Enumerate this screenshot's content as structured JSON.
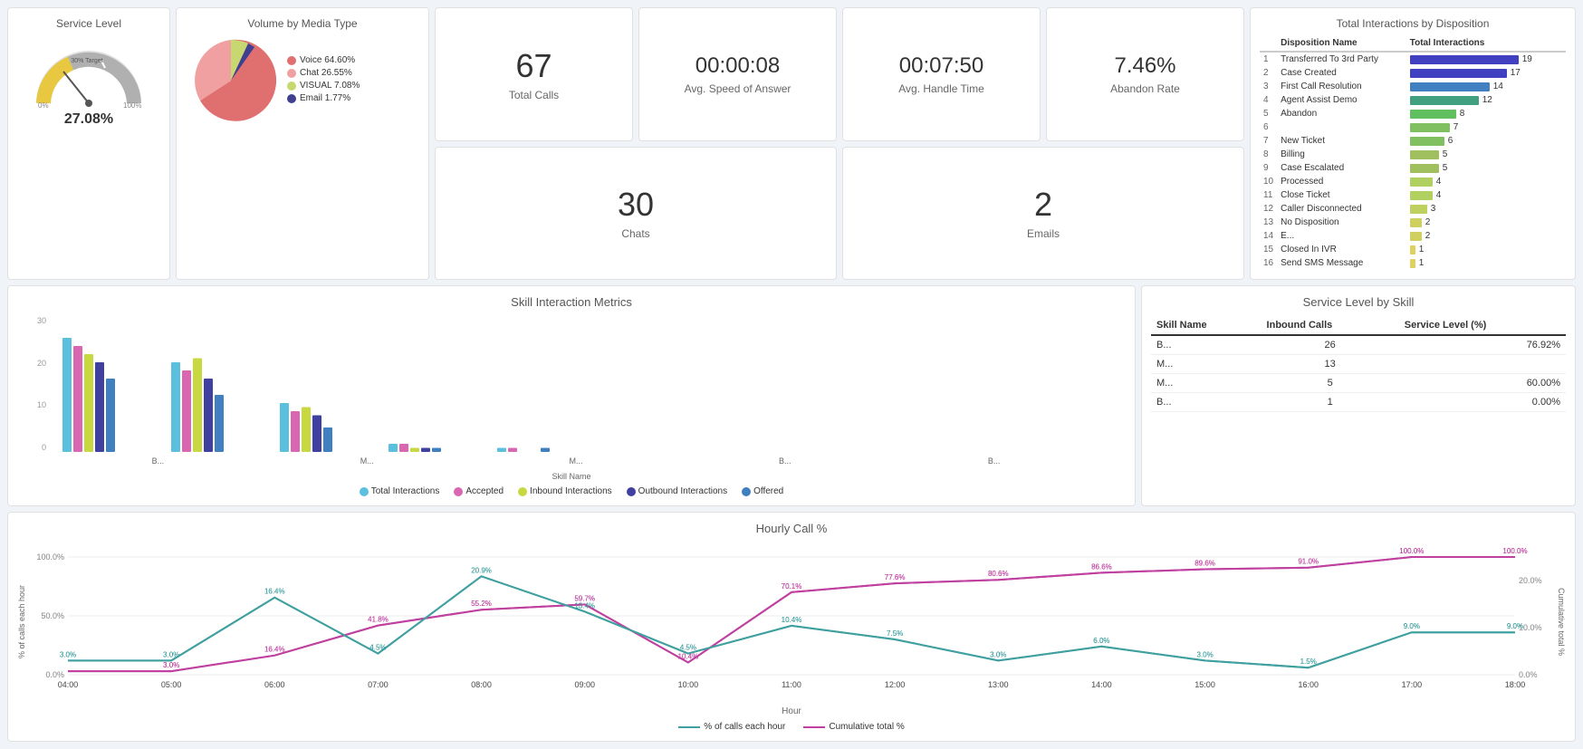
{
  "servicelevel": {
    "title": "Service Level",
    "value": "27.08%",
    "target": "30% Target",
    "gauge_pct": 27.08
  },
  "volume": {
    "title": "Volume by Media Type",
    "segments": [
      {
        "label": "Voice 64.60%",
        "pct": 64.6,
        "color": "#e07070"
      },
      {
        "label": "Chat 26.55%",
        "pct": 26.55,
        "color": "#f0a0a0"
      },
      {
        "label": "VISUAL 7.08%",
        "pct": 7.08,
        "color": "#c8d870"
      },
      {
        "label": "Email 1.77%",
        "pct": 1.77,
        "color": "#4040a0"
      }
    ]
  },
  "stats": {
    "total_calls": {
      "value": "67",
      "label": "Total Calls"
    },
    "avg_speed": {
      "value": "00:00:08",
      "label": "Avg. Speed of Answer"
    },
    "avg_handle": {
      "value": "00:07:50",
      "label": "Avg. Handle Time"
    },
    "abandon": {
      "value": "7.46%",
      "label": "Abandon Rate"
    },
    "chats": {
      "value": "30",
      "label": "Chats"
    },
    "emails": {
      "value": "2",
      "label": "Emails"
    }
  },
  "skill_metrics": {
    "title": "Skill Interaction Metrics",
    "x_label": "Skill Name",
    "y_max": 30,
    "groups": [
      {
        "name": "B...",
        "bars": [
          28,
          26,
          24,
          22,
          18
        ]
      },
      {
        "name": "M...",
        "bars": [
          22,
          20,
          23,
          18,
          14
        ]
      },
      {
        "name": "M...",
        "bars": [
          12,
          10,
          11,
          9,
          6
        ]
      },
      {
        "name": "B...",
        "bars": [
          2,
          2,
          1,
          1,
          1
        ]
      },
      {
        "name": "B...",
        "bars": [
          1,
          1,
          0,
          0,
          1
        ]
      }
    ],
    "legend": [
      {
        "label": "Total Interactions",
        "color": "#5bc0de"
      },
      {
        "label": "Accepted",
        "color": "#d966b0"
      },
      {
        "label": "Inbound Interactions",
        "color": "#c8d840"
      },
      {
        "label": "Outbound Interactions",
        "color": "#4040a0"
      },
      {
        "label": "Offered",
        "color": "#4080c0"
      }
    ]
  },
  "service_skill": {
    "title": "Service Level by Skill",
    "columns": [
      "Skill Name",
      "Inbound Calls",
      "Service Level (%)"
    ],
    "rows": [
      {
        "name": "B...",
        "calls": 26,
        "level": "76.92%"
      },
      {
        "name": "M...",
        "calls": 13,
        "level": ""
      },
      {
        "name": "M...",
        "calls": 5,
        "level": "60.00%"
      },
      {
        "name": "B...",
        "calls": 1,
        "level": "0.00%"
      }
    ]
  },
  "disposition": {
    "title": "Total Interactions by Disposition",
    "col1": "Disposition Name",
    "col2": "Total Interactions",
    "items": [
      {
        "rank": 1,
        "name": "Transferred To 3rd Party",
        "count": 19,
        "color": "#4040c0"
      },
      {
        "rank": 2,
        "name": "Case Created",
        "count": 17,
        "color": "#4040c0"
      },
      {
        "rank": 3,
        "name": "First Call Resolution",
        "count": 14,
        "color": "#4080c0"
      },
      {
        "rank": 4,
        "name": "Agent Assist Demo",
        "count": 12,
        "color": "#40a080"
      },
      {
        "rank": 5,
        "name": "Abandon",
        "count": 8,
        "color": "#60c060"
      },
      {
        "rank": 6,
        "name": "",
        "count": 7,
        "color": "#80c060"
      },
      {
        "rank": 7,
        "name": "New Ticket",
        "count": 6,
        "color": "#80c060"
      },
      {
        "rank": 8,
        "name": "Billing",
        "count": 5,
        "color": "#a0c060"
      },
      {
        "rank": 9,
        "name": "Case Escalated",
        "count": 5,
        "color": "#a0c060"
      },
      {
        "rank": 10,
        "name": "Processed",
        "count": 4,
        "color": "#b0d060"
      },
      {
        "rank": 11,
        "name": "Close Ticket",
        "count": 4,
        "color": "#b0d060"
      },
      {
        "rank": 12,
        "name": "Caller Disconnected",
        "count": 3,
        "color": "#c0d060"
      },
      {
        "rank": 13,
        "name": "No Disposition",
        "count": 2,
        "color": "#d0d060"
      },
      {
        "rank": 14,
        "name": "E...",
        "count": 2,
        "color": "#d0d060"
      },
      {
        "rank": 15,
        "name": "Closed In IVR",
        "count": 1,
        "color": "#e0d060"
      },
      {
        "rank": 16,
        "name": "Send SMS Message",
        "count": 1,
        "color": "#e0d060"
      }
    ],
    "max_count": 19
  },
  "hourly": {
    "title": "Hourly Call %",
    "x_label": "Hour",
    "y_left_label": "% of calls each hour",
    "y_right_label": "Cumulative total %",
    "hours": [
      "04:00",
      "05:00",
      "06:00",
      "07:00",
      "08:00",
      "09:00",
      "10:00",
      "11:00",
      "12:00",
      "13:00",
      "14:00",
      "15:00",
      "16:00",
      "17:00",
      "18:00"
    ],
    "series1": {
      "label": "% of calls each hour",
      "color": "#40a0a0",
      "points": [
        3.0,
        3.0,
        16.4,
        4.5,
        20.9,
        13.4,
        4.5,
        10.4,
        7.5,
        3.0,
        6.0,
        3.0,
        1.5,
        9.0,
        9.0
      ]
    },
    "series2": {
      "label": "Cumulative total %",
      "color": "#c040a0",
      "points": [
        3.0,
        3.0,
        16.4,
        41.8,
        55.2,
        59.7,
        10.4,
        70.1,
        77.6,
        80.6,
        86.6,
        89.6,
        91.0,
        100.0,
        100.0
      ]
    }
  }
}
